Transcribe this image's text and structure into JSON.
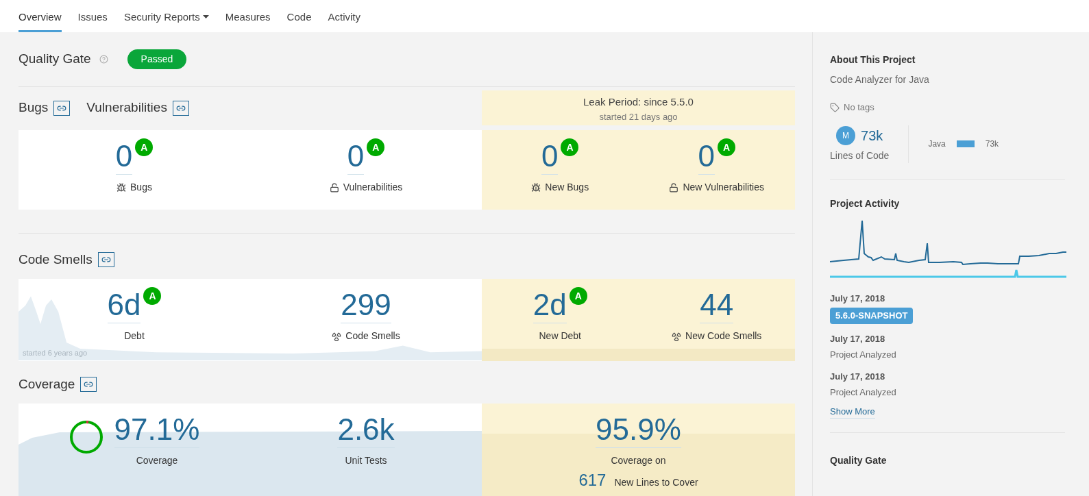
{
  "nav": {
    "tabs": [
      {
        "label": "Overview",
        "selected": true,
        "dropdown": false
      },
      {
        "label": "Issues",
        "selected": false,
        "dropdown": false
      },
      {
        "label": "Security Reports",
        "selected": false,
        "dropdown": true
      },
      {
        "label": "Measures",
        "selected": false,
        "dropdown": false
      },
      {
        "label": "Code",
        "selected": false,
        "dropdown": false
      },
      {
        "label": "Activity",
        "selected": false,
        "dropdown": false
      }
    ]
  },
  "quality_gate": {
    "label": "Quality Gate",
    "status": "Passed",
    "passed": true
  },
  "leak_period": {
    "title": "Leak Period: since 5.5.0",
    "subtitle": "started 21 days ago"
  },
  "sections": [
    {
      "kind": "issues",
      "headers": [
        "Bugs",
        "Vulnerabilities"
      ],
      "overall": [
        {
          "value": "0",
          "rating": "A",
          "label": "Bugs"
        },
        {
          "value": "0",
          "rating": "A",
          "label": "Vulnerabilities"
        }
      ],
      "leak": [
        {
          "value": "0",
          "rating": "A",
          "label": "New Bugs"
        },
        {
          "value": "0",
          "rating": "A",
          "label": "New Vulnerabilities"
        }
      ]
    },
    {
      "kind": "smells",
      "headers": [
        "Code Smells"
      ],
      "caption": "started 6 years ago",
      "overall": [
        {
          "value": "6d",
          "rating": "A",
          "label": "Debt"
        },
        {
          "value": "299",
          "label": "Code Smells"
        }
      ],
      "leak": [
        {
          "value": "2d",
          "rating": "A",
          "label": "New Debt"
        },
        {
          "value": "44",
          "label": "New Code Smells"
        }
      ]
    },
    {
      "kind": "coverage",
      "headers": [
        "Coverage"
      ],
      "overall": [
        {
          "value": "97.1%",
          "label": "Coverage"
        },
        {
          "value": "2.6k",
          "label": "Unit Tests"
        }
      ],
      "leak": [
        {
          "value": "95.9%",
          "label": "Coverage on",
          "sub_value": "617",
          "sub_label": "New Lines to Cover"
        }
      ]
    }
  ],
  "sidebar": {
    "about": {
      "title": "About This Project",
      "description": "Code Analyzer for Java",
      "tags": "No tags",
      "loc": {
        "badge": "M",
        "value": "73k",
        "label": "Lines of Code"
      },
      "languages": [
        {
          "name": "Java",
          "value": "73k"
        }
      ]
    },
    "activity": {
      "title": "Project Activity",
      "events": [
        {
          "date": "July 17, 2018",
          "kind": "version",
          "text": "5.6.0-SNAPSHOT"
        },
        {
          "date": "July 17, 2018",
          "kind": "analysis",
          "text": "Project Analyzed"
        },
        {
          "date": "July 17, 2018",
          "kind": "analysis",
          "text": "Project Analyzed"
        }
      ],
      "show_more": "Show More"
    },
    "quality_gate_title": "Quality Gate"
  }
}
